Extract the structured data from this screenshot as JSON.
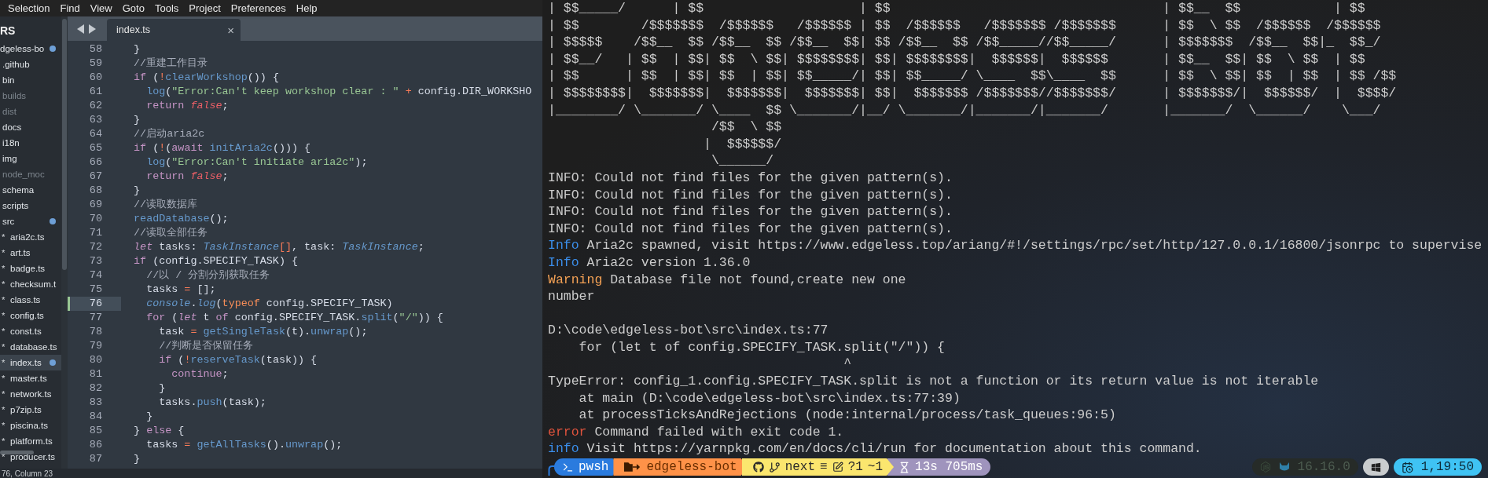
{
  "editor": {
    "menu": [
      "Selection",
      "Find",
      "View",
      "Goto",
      "Tools",
      "Project",
      "Preferences",
      "Help"
    ],
    "sidebar": {
      "header": "RS",
      "items": [
        {
          "name": "dgeless-bo",
          "selected": false,
          "modified": true,
          "ignored": false,
          "children": [
            {
              "name": ".github",
              "selected": false,
              "modified": false,
              "ignored": false
            },
            {
              "name": "bin",
              "selected": false,
              "modified": false,
              "ignored": false
            },
            {
              "name": "builds",
              "selected": false,
              "modified": false,
              "ignored": true
            },
            {
              "name": "dist",
              "selected": false,
              "modified": false,
              "ignored": true
            },
            {
              "name": "docs",
              "selected": false,
              "modified": false,
              "ignored": false
            },
            {
              "name": "i18n",
              "selected": false,
              "modified": false,
              "ignored": false
            },
            {
              "name": "img",
              "selected": false,
              "modified": false,
              "ignored": false
            },
            {
              "name": "node_moc",
              "selected": false,
              "modified": false,
              "ignored": true
            },
            {
              "name": "schema",
              "selected": false,
              "modified": false,
              "ignored": false
            },
            {
              "name": "scripts",
              "selected": false,
              "modified": false,
              "ignored": false
            },
            {
              "name": "src",
              "selected": false,
              "modified": true,
              "ignored": false,
              "children": [
                {
                  "bullet": "*",
                  "name": "aria2c.ts",
                  "selected": false,
                  "modified": false,
                  "ignored": false
                },
                {
                  "bullet": "*",
                  "name": "art.ts",
                  "selected": false,
                  "modified": false,
                  "ignored": false
                },
                {
                  "bullet": "*",
                  "name": "badge.ts",
                  "selected": false,
                  "modified": false,
                  "ignored": false
                },
                {
                  "bullet": "*",
                  "name": "checksum.t",
                  "selected": false,
                  "modified": false,
                  "ignored": false
                },
                {
                  "bullet": "*",
                  "name": "class.ts",
                  "selected": false,
                  "modified": false,
                  "ignored": false
                },
                {
                  "bullet": "*",
                  "name": "config.ts",
                  "selected": false,
                  "modified": false,
                  "ignored": false
                },
                {
                  "bullet": "*",
                  "name": "const.ts",
                  "selected": false,
                  "modified": false,
                  "ignored": false
                },
                {
                  "bullet": "*",
                  "name": "database.ts",
                  "selected": false,
                  "modified": false,
                  "ignored": false
                },
                {
                  "bullet": "*",
                  "name": "index.ts",
                  "selected": true,
                  "modified": true,
                  "ignored": false
                },
                {
                  "bullet": "*",
                  "name": "master.ts",
                  "selected": false,
                  "modified": false,
                  "ignored": false
                },
                {
                  "bullet": "*",
                  "name": "network.ts",
                  "selected": false,
                  "modified": false,
                  "ignored": false
                },
                {
                  "bullet": "*",
                  "name": "p7zip.ts",
                  "selected": false,
                  "modified": false,
                  "ignored": false
                },
                {
                  "bullet": "*",
                  "name": "piscina.ts",
                  "selected": false,
                  "modified": false,
                  "ignored": false
                },
                {
                  "bullet": "*",
                  "name": "platform.ts",
                  "selected": false,
                  "modified": false,
                  "ignored": false
                },
                {
                  "bullet": "*",
                  "name": "producer.ts",
                  "selected": false,
                  "modified": false,
                  "ignored": false
                }
              ]
            }
          ]
        }
      ]
    },
    "tabs": [
      {
        "label": "index.ts",
        "close": "×",
        "selected": true
      }
    ],
    "lines": [
      {
        "number": "58",
        "current": false,
        "tokens": [
          {
            "kind": "plain",
            "text": "  }"
          }
        ]
      },
      {
        "number": "59",
        "current": false,
        "tokens": [
          {
            "kind": "comment",
            "text": "  //重建工作目录"
          }
        ]
      },
      {
        "number": "60",
        "current": false,
        "tokens": [
          {
            "kind": "keyword",
            "text": "  if"
          },
          {
            "kind": "plain",
            "text": " ("
          },
          {
            "kind": "operator",
            "text": "!"
          },
          {
            "kind": "function",
            "text": "clearWorkshop"
          },
          {
            "kind": "plain",
            "text": "()) {"
          }
        ]
      },
      {
        "number": "61",
        "current": false,
        "tokens": [
          {
            "kind": "function",
            "text": "    log"
          },
          {
            "kind": "plain",
            "text": "("
          },
          {
            "kind": "string",
            "text": "\"Error:Can't keep workshop clear : \""
          },
          {
            "kind": "operator",
            "text": " +"
          },
          {
            "kind": "plain",
            "text": " config.DIR_WORKSHO"
          }
        ]
      },
      {
        "number": "62",
        "current": false,
        "tokens": [
          {
            "kind": "keyword",
            "text": "    return "
          },
          {
            "kind": "constant",
            "text": "false"
          },
          {
            "kind": "plain",
            "text": ";"
          }
        ]
      },
      {
        "number": "63",
        "current": false,
        "tokens": [
          {
            "kind": "plain",
            "text": "  }"
          }
        ]
      },
      {
        "number": "64",
        "current": false,
        "tokens": [
          {
            "kind": "comment",
            "text": "  //启动aria2c"
          }
        ]
      },
      {
        "number": "65",
        "current": false,
        "tokens": [
          {
            "kind": "keyword",
            "text": "  if"
          },
          {
            "kind": "plain",
            "text": " ("
          },
          {
            "kind": "operator",
            "text": "!"
          },
          {
            "kind": "plain",
            "text": "("
          },
          {
            "kind": "keyword",
            "text": "await "
          },
          {
            "kind": "function",
            "text": "initAria2c"
          },
          {
            "kind": "plain",
            "text": "())) {"
          }
        ]
      },
      {
        "number": "66",
        "current": false,
        "tokens": [
          {
            "kind": "function",
            "text": "    log"
          },
          {
            "kind": "plain",
            "text": "("
          },
          {
            "kind": "string",
            "text": "\"Error:Can't initiate aria2c\""
          },
          {
            "kind": "plain",
            "text": ");"
          }
        ]
      },
      {
        "number": "67",
        "current": false,
        "tokens": [
          {
            "kind": "keyword",
            "text": "    return "
          },
          {
            "kind": "constant",
            "text": "false"
          },
          {
            "kind": "plain",
            "text": ";"
          }
        ]
      },
      {
        "number": "68",
        "current": false,
        "tokens": [
          {
            "kind": "plain",
            "text": "  }"
          }
        ]
      },
      {
        "number": "69",
        "current": false,
        "tokens": [
          {
            "kind": "comment",
            "text": "  //读取数据库"
          }
        ]
      },
      {
        "number": "70",
        "current": false,
        "tokens": [
          {
            "kind": "function",
            "text": "  readDatabase"
          },
          {
            "kind": "plain",
            "text": "();"
          }
        ]
      },
      {
        "number": "71",
        "current": false,
        "tokens": [
          {
            "kind": "comment",
            "text": "  //读取全部任务"
          }
        ]
      },
      {
        "number": "72",
        "current": false,
        "tokens": [
          {
            "kind": "keyword-italic",
            "text": "  let"
          },
          {
            "kind": "plain",
            "text": " tasks: "
          },
          {
            "kind": "type",
            "text": "TaskInstance"
          },
          {
            "kind": "operator",
            "text": "[]"
          },
          {
            "kind": "plain",
            "text": ", task: "
          },
          {
            "kind": "type",
            "text": "TaskInstance"
          },
          {
            "kind": "plain",
            "text": ";"
          }
        ]
      },
      {
        "number": "73",
        "current": false,
        "tokens": [
          {
            "kind": "keyword",
            "text": "  if"
          },
          {
            "kind": "plain",
            "text": " (config.SPECIFY_TASK) {"
          }
        ]
      },
      {
        "number": "74",
        "current": false,
        "tokens": [
          {
            "kind": "comment",
            "text": "    //以 / 分割分别获取任务"
          }
        ]
      },
      {
        "number": "75",
        "current": false,
        "tokens": [
          {
            "kind": "plain",
            "text": "    tasks "
          },
          {
            "kind": "operator",
            "text": "="
          },
          {
            "kind": "plain",
            "text": " [];"
          }
        ]
      },
      {
        "number": "76",
        "current": true,
        "tokens": [
          {
            "kind": "type",
            "text": "    console"
          },
          {
            "kind": "plain",
            "text": "."
          },
          {
            "kind": "type",
            "text": "log"
          },
          {
            "kind": "plain",
            "text": "("
          },
          {
            "kind": "storage",
            "text": "typeof"
          },
          {
            "kind": "plain",
            "text": " config.SPECIFY_TASK)"
          }
        ]
      },
      {
        "number": "77",
        "current": false,
        "tokens": [
          {
            "kind": "keyword",
            "text": "    for"
          },
          {
            "kind": "plain",
            "text": " ("
          },
          {
            "kind": "keyword-italic",
            "text": "let"
          },
          {
            "kind": "plain",
            "text": " t "
          },
          {
            "kind": "keyword",
            "text": "of"
          },
          {
            "kind": "plain",
            "text": " config.SPECIFY_TASK."
          },
          {
            "kind": "function",
            "text": "split"
          },
          {
            "kind": "plain",
            "text": "("
          },
          {
            "kind": "string",
            "text": "\"/\""
          },
          {
            "kind": "plain",
            "text": ")) {"
          }
        ]
      },
      {
        "number": "78",
        "current": false,
        "tokens": [
          {
            "kind": "plain",
            "text": "      task "
          },
          {
            "kind": "operator",
            "text": "= "
          },
          {
            "kind": "function",
            "text": "getSingleTask"
          },
          {
            "kind": "plain",
            "text": "(t)."
          },
          {
            "kind": "function",
            "text": "unwrap"
          },
          {
            "kind": "plain",
            "text": "();"
          }
        ]
      },
      {
        "number": "79",
        "current": false,
        "tokens": [
          {
            "kind": "comment",
            "text": "      //判断是否保留任务"
          }
        ]
      },
      {
        "number": "80",
        "current": false,
        "tokens": [
          {
            "kind": "keyword",
            "text": "      if"
          },
          {
            "kind": "plain",
            "text": " ("
          },
          {
            "kind": "operator",
            "text": "!"
          },
          {
            "kind": "function",
            "text": "reserveTask"
          },
          {
            "kind": "plain",
            "text": "(task)) {"
          }
        ]
      },
      {
        "number": "81",
        "current": false,
        "tokens": [
          {
            "kind": "keyword",
            "text": "        continue"
          },
          {
            "kind": "plain",
            "text": ";"
          }
        ]
      },
      {
        "number": "82",
        "current": false,
        "tokens": [
          {
            "kind": "plain",
            "text": "      }"
          }
        ]
      },
      {
        "number": "83",
        "current": false,
        "tokens": [
          {
            "kind": "plain",
            "text": "      tasks."
          },
          {
            "kind": "function",
            "text": "push"
          },
          {
            "kind": "plain",
            "text": "(task);"
          }
        ]
      },
      {
        "number": "84",
        "current": false,
        "tokens": [
          {
            "kind": "plain",
            "text": "    }"
          }
        ]
      },
      {
        "number": "85",
        "current": false,
        "tokens": [
          {
            "kind": "plain",
            "text": "  } "
          },
          {
            "kind": "keyword",
            "text": "else"
          },
          {
            "kind": "plain",
            "text": " {"
          }
        ]
      },
      {
        "number": "86",
        "current": false,
        "tokens": [
          {
            "kind": "plain",
            "text": "    tasks "
          },
          {
            "kind": "operator",
            "text": "= "
          },
          {
            "kind": "function",
            "text": "getAllTasks"
          },
          {
            "kind": "plain",
            "text": "()."
          },
          {
            "kind": "function",
            "text": "unwrap"
          },
          {
            "kind": "plain",
            "text": "();"
          }
        ]
      },
      {
        "number": "87",
        "current": false,
        "tokens": [
          {
            "kind": "plain",
            "text": "  }"
          }
        ]
      }
    ],
    "status": "76, Column 23"
  },
  "terminal": {
    "lines": [
      {
        "kind": "art",
        "text": "| $$_____/      | $$                    | $$                                   | $$__  $$            | $$"
      },
      {
        "kind": "art",
        "text": "| $$        /$$$$$$$  /$$$$$$   /$$$$$$ | $$  /$$$$$$   /$$$$$$$ /$$$$$$$      | $$  \\ $$  /$$$$$$  /$$$$$$"
      },
      {
        "kind": "art",
        "text": "| $$$$$    /$$__  $$ /$$__  $$ /$$__  $$| $$ /$$__  $$ /$$_____//$$_____/      | $$$$$$$  /$$__  $$|_  $$_/"
      },
      {
        "kind": "art",
        "text": "| $$__/   | $$  | $$| $$  \\ $$| $$$$$$$$| $$| $$$$$$$$|  $$$$$$|  $$$$$$       | $$__  $$| $$  \\ $$  | $$"
      },
      {
        "kind": "art",
        "text": "| $$      | $$  | $$| $$  | $$| $$_____/| $$| $$_____/ \\____  $$\\____  $$      | $$  \\ $$| $$  | $$  | $$ /$$"
      },
      {
        "kind": "art",
        "text": "| $$$$$$$$|  $$$$$$$|  $$$$$$$|  $$$$$$$| $$|  $$$$$$$ /$$$$$$$//$$$$$$$/      | $$$$$$$/|  $$$$$$/  |  $$$$/"
      },
      {
        "kind": "art",
        "text": "|________/ \\_______/ \\____  $$ \\_______/|__/ \\_______/|_______/|_______/       |_______/  \\______/    \\___/"
      },
      {
        "kind": "art",
        "text": "                     /$$  \\ $$"
      },
      {
        "kind": "art",
        "text": "                    |  $$$$$$/"
      },
      {
        "kind": "art",
        "text": "                     \\______/"
      },
      {
        "kind": "log",
        "text": "INFO: Could not find files for the given pattern(s)."
      },
      {
        "kind": "log",
        "text": "INFO: Could not find files for the given pattern(s)."
      },
      {
        "kind": "log",
        "text": "INFO: Could not find files for the given pattern(s)."
      },
      {
        "kind": "log",
        "text": "INFO: Could not find files for the given pattern(s)."
      },
      {
        "kind": "log",
        "tag": {
          "kind": "info",
          "text": "Info"
        },
        "text": "Aria2c spawned, visit https://www.edgeless.top/ariang/#!/settings/rpc/set/http/127.0.0.1/16800/jsonrpc to supervise"
      },
      {
        "kind": "log",
        "tag": {
          "kind": "info",
          "text": "Info"
        },
        "text": "Aria2c version 1.36.0"
      },
      {
        "kind": "log",
        "tag": {
          "kind": "warning",
          "text": "Warning"
        },
        "text": "Database file not found,create new one"
      },
      {
        "kind": "log",
        "text": "number"
      },
      {
        "kind": "blank"
      },
      {
        "kind": "log",
        "text": "D:\\code\\edgeless-bot\\src\\index.ts:77"
      },
      {
        "kind": "log",
        "text": "    for (let t of config.SPECIFY_TASK.split(\"/\")) {"
      },
      {
        "kind": "log",
        "text": "                                      ^"
      },
      {
        "kind": "log",
        "text": "TypeError: config_1.config.SPECIFY_TASK.split is not a function or its return value is not iterable"
      },
      {
        "kind": "log",
        "text": "    at main (D:\\code\\edgeless-bot\\src\\index.ts:77:39)"
      },
      {
        "kind": "log",
        "text": "    at processTicksAndRejections (node:internal/process/task_queues:96:5)"
      },
      {
        "kind": "log",
        "tag": {
          "kind": "error",
          "text": "error"
        },
        "text": "Command failed with exit code 1."
      },
      {
        "kind": "log",
        "tag": {
          "kind": "info",
          "text": "info"
        },
        "text": "Visit https://yarnpkg.com/en/docs/cli/run for documentation about this command."
      }
    ],
    "prompt": {
      "shell": "pwsh",
      "path": "edgeless-bot",
      "branch": "next",
      "branch_status": "≡",
      "untracked": "?1",
      "changed": "~1",
      "duration": "13s 705ms",
      "node_version": "16.16.0",
      "time": "1,19:50"
    }
  }
}
